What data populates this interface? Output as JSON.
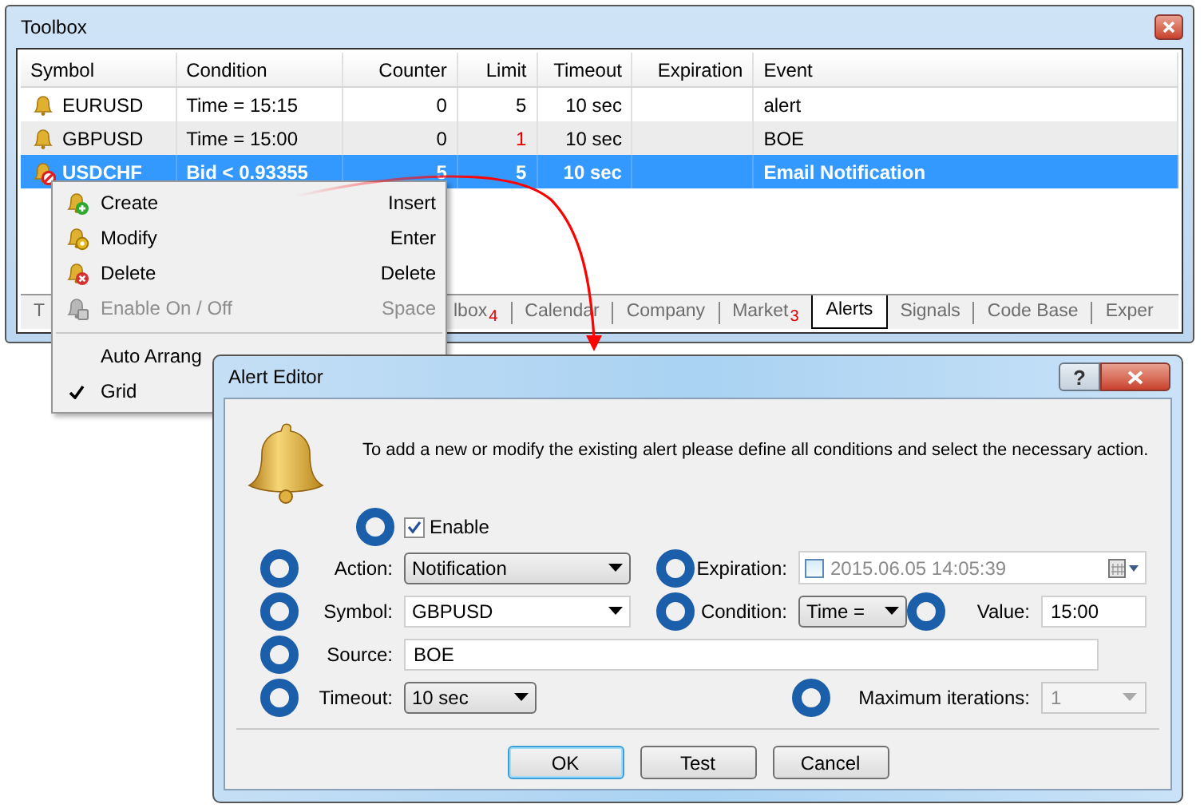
{
  "toolbox": {
    "title": "Toolbox",
    "columns": [
      {
        "label": "Symbol"
      },
      {
        "label": "Condition"
      },
      {
        "label": "Counter"
      },
      {
        "label": "Limit"
      },
      {
        "label": "Timeout"
      },
      {
        "label": "Expiration"
      },
      {
        "label": "Event"
      }
    ],
    "rows": [
      {
        "symbol": "EURUSD",
        "condition": "Time = 15:15",
        "counter": "0",
        "limit": "5",
        "timeout": "10 sec",
        "event": "alert",
        "enabled": true,
        "limit_warning": false,
        "selected": false
      },
      {
        "symbol": "GBPUSD",
        "condition": "Time = 15:00",
        "counter": "0",
        "limit": "1",
        "timeout": "10 sec",
        "event": "BOE",
        "enabled": true,
        "limit_warning": true,
        "selected": false
      },
      {
        "symbol": "USDCHF",
        "condition": "Bid < 0.93355",
        "counter": "5",
        "limit": "5",
        "timeout": "10 sec",
        "event": "Email Notification",
        "enabled": false,
        "limit_warning": false,
        "selected": true
      }
    ],
    "tabs": [
      {
        "label": "T",
        "selected": false
      },
      {
        "label": "lbox",
        "count": "4",
        "selected": false
      },
      {
        "label": "Calendar",
        "selected": false
      },
      {
        "label": "Company",
        "selected": false
      },
      {
        "label": "Market",
        "count": "3",
        "selected": false
      },
      {
        "label": "Alerts",
        "selected": true
      },
      {
        "label": "Signals",
        "selected": false
      },
      {
        "label": "Code Base",
        "selected": false
      },
      {
        "label": "Exper",
        "selected": false
      }
    ]
  },
  "context_menu": {
    "items": [
      {
        "kind": "create",
        "label": "Create",
        "shortcut": "Insert",
        "disabled": false
      },
      {
        "kind": "modify",
        "label": "Modify",
        "shortcut": "Enter",
        "disabled": false
      },
      {
        "kind": "delete",
        "label": "Delete",
        "shortcut": "Delete",
        "disabled": false
      },
      {
        "kind": "toggle",
        "label": "Enable On / Off",
        "shortcut": "Space",
        "disabled": true
      },
      {
        "kind": "separator"
      },
      {
        "kind": "option",
        "label": "Auto Arrang",
        "disabled": false,
        "checked": false
      },
      {
        "kind": "option",
        "label": "Grid",
        "disabled": false,
        "checked": true
      }
    ]
  },
  "alert_editor": {
    "title": "Alert Editor",
    "help_button": "?",
    "description": "To add a new or modify the existing alert please define all conditions and select the necessary action.",
    "enable": {
      "label": "Enable",
      "checked": true
    },
    "action": {
      "label": "Action:",
      "value": "Notification"
    },
    "expiration": {
      "label": "Expiration:",
      "checked": false,
      "value": "2015.06.05 14:05:39"
    },
    "symbol": {
      "label": "Symbol:",
      "value": "GBPUSD"
    },
    "condition": {
      "label": "Condition:",
      "value": "Time ="
    },
    "value": {
      "label": "Value:",
      "value": "15:00"
    },
    "source": {
      "label": "Source:",
      "value": "BOE"
    },
    "timeout": {
      "label": "Timeout:",
      "value": "10 sec"
    },
    "max_iterations": {
      "label": "Maximum iterations:",
      "value": "1",
      "disabled": true
    },
    "buttons": [
      {
        "label": "OK",
        "default": true
      },
      {
        "label": "Test",
        "default": false
      },
      {
        "label": "Cancel",
        "default": false
      }
    ]
  }
}
